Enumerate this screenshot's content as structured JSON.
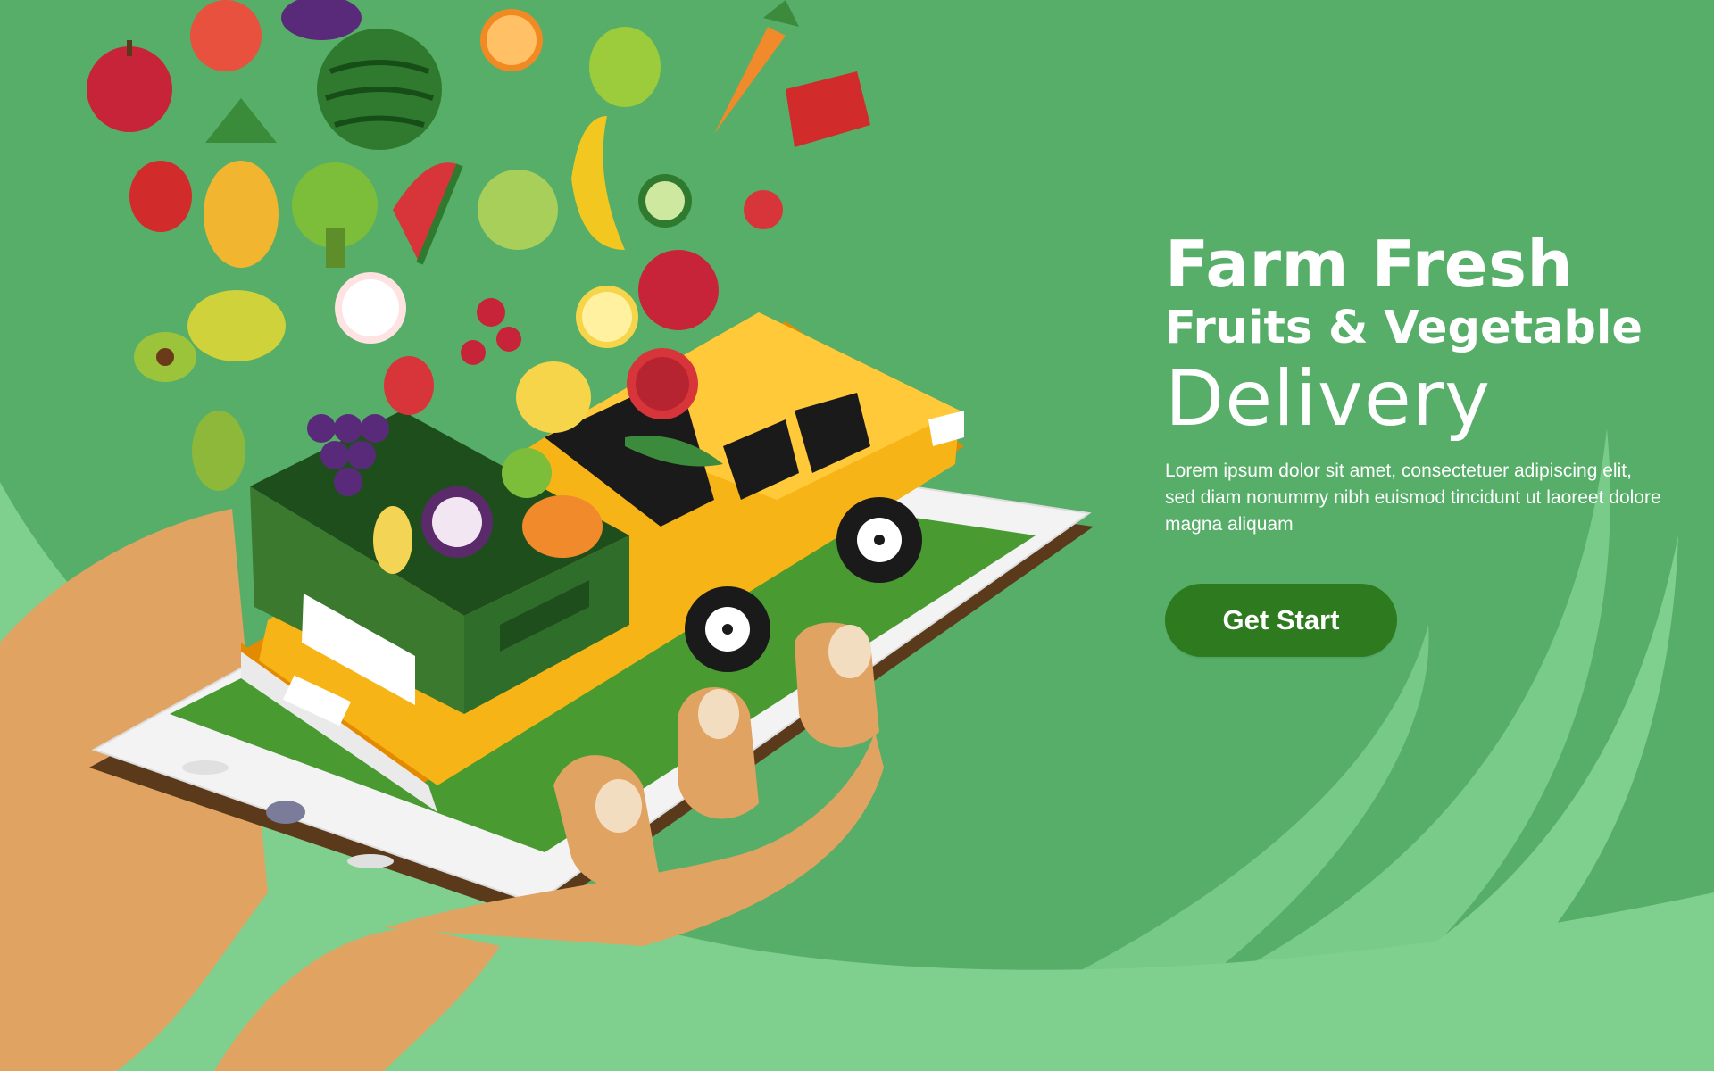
{
  "hero": {
    "title_line1": "Farm Fresh",
    "title_line2": "Fruits & Vegetable",
    "title_line3": "Delivery",
    "description": "Lorem ipsum dolor sit amet, consectetuer adipiscing elit, sed diam nonummy nibh euismod tincidunt ut laoreet dolore magna aliquam",
    "cta_label": "Get Start"
  },
  "colors": {
    "background": "#56ae69",
    "background_accent": "#7fd08f",
    "cta_background": "#2d7a1f",
    "truck": "#f7b416",
    "crate": "#2f6e2a",
    "text": "#ffffff"
  },
  "illustration": {
    "icons": [
      "hand-holding-phone-icon",
      "delivery-truck-icon",
      "produce-crate-icon",
      "apple-icon",
      "peach-icon",
      "eggplant-icon",
      "watermelon-icon",
      "orange-slice-icon",
      "pear-icon",
      "carrot-icon",
      "red-pepper-icon",
      "pineapple-icon",
      "broccoli-icon",
      "watermelon-slice-icon",
      "custard-apple-icon",
      "banana-icon",
      "cucumber-slice-icon",
      "strawberry-icon",
      "tomato-icon",
      "lemon-slice-icon",
      "mango-icon",
      "avocado-icon",
      "cherry-icon",
      "grapes-icon",
      "mangosteen-icon",
      "corn-icon",
      "pumpkin-icon",
      "pea-pod-icon"
    ]
  }
}
